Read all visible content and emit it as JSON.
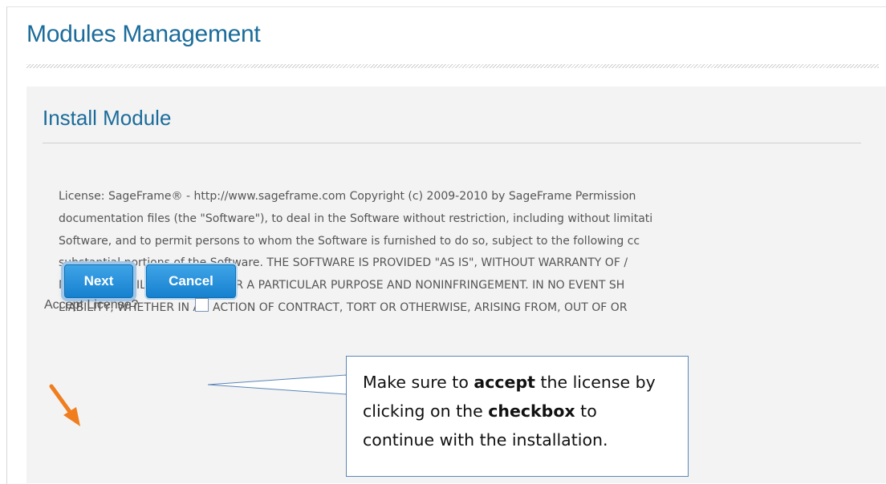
{
  "page": {
    "title": "Modules Management"
  },
  "panel": {
    "title": "Install Module",
    "license_lines": [
      "License: SageFrame® - http://www.sageframe.com Copyright (c) 2009-2010 by SageFrame Permission",
      "documentation files (the \"Software\"), to deal in the Software without restriction, including without limitati",
      "Software, and to permit persons to whom the Software is furnished to do so, subject to the following cc",
      "substantial portions of the Software. THE SOFTWARE IS PROVIDED \"AS IS\", WITHOUT WARRANTY OF /",
      "MERCHANTABILITY, FITNESS FOR A PARTICULAR PURPOSE AND NONINFRINGEMENT. IN NO EVENT SH",
      "LIABILITY, WHETHER IN AN ACTION OF CONTRACT, TORT OR OTHERWISE, ARISING FROM, OUT OF OR"
    ],
    "accept_label": "Accept License?",
    "accept_checked": false,
    "buttons": {
      "next": "Next",
      "cancel": "Cancel"
    }
  },
  "callout": {
    "text_1": "Make sure to ",
    "bold_1": "accept",
    "text_2": " the license by clicking on the ",
    "bold_2": "checkbox",
    "text_3": " to continue with the installation."
  },
  "icons": {
    "arrow": "arrow-pointer-icon"
  },
  "colors": {
    "title": "#1b6c9b",
    "button": "#1681cf",
    "callout_border": "#5b86b9",
    "arrow": "#f07d1e"
  }
}
